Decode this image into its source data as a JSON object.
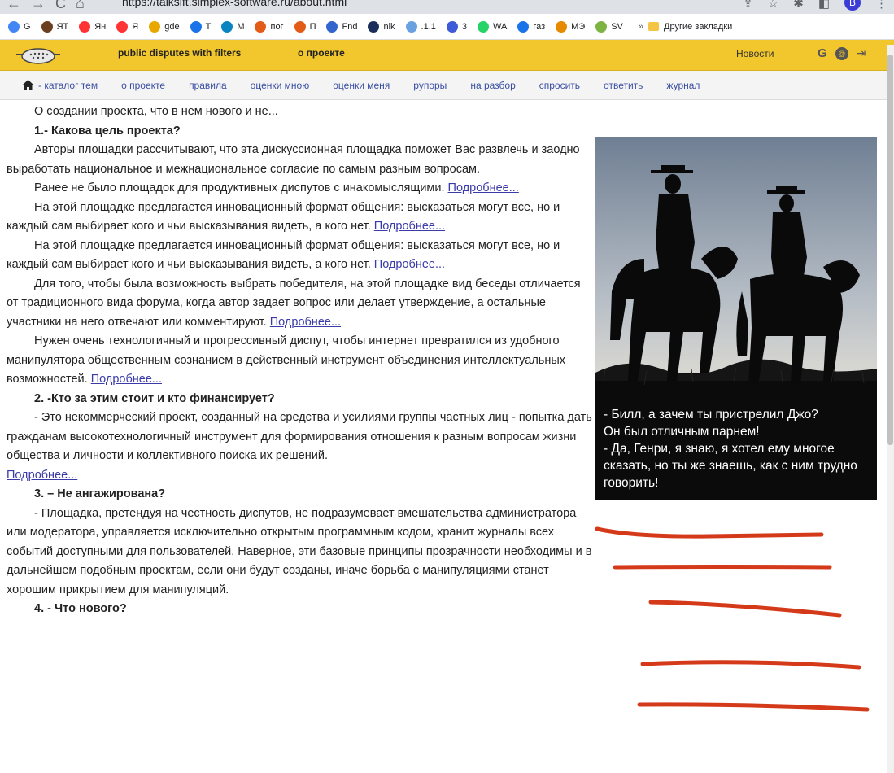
{
  "browser": {
    "url": "https://talksift.simplex-software.ru/about.html",
    "profile_initial": "B",
    "bookmarks": [
      {
        "label": "G",
        "color": "#4285f4"
      },
      {
        "label": "ЯТ",
        "color": "#6b3f20"
      },
      {
        "label": "Ян",
        "color": "#f33"
      },
      {
        "label": "Я",
        "color": "#f33"
      },
      {
        "label": "gde",
        "color": "#e8a800"
      },
      {
        "label": "Т",
        "color": "#1a73e8"
      },
      {
        "label": "М",
        "color": "#0a84c1"
      },
      {
        "label": "пог",
        "color": "#e25b17"
      },
      {
        "label": "П",
        "color": "#e25b17"
      },
      {
        "label": "Fnd",
        "color": "#3366cc"
      },
      {
        "label": "nik",
        "color": "#1b2d5a"
      },
      {
        "label": ".1.1",
        "color": "#6aa1e0"
      },
      {
        "label": "3",
        "color": "#3d5bd8"
      },
      {
        "label": "WA",
        "color": "#25d366"
      },
      {
        "label": "газ",
        "color": "#1a73e8"
      },
      {
        "label": "МЭ",
        "color": "#e68a00"
      },
      {
        "label": "SV",
        "color": "#7cb342"
      }
    ],
    "more_label": "»",
    "other_bookmarks": "Другие закладки"
  },
  "header": {
    "title": "public disputes with filters",
    "about": "о проекте",
    "news": "Новости",
    "g_icon": "G"
  },
  "menu": [
    "- каталог тем",
    "о проекте",
    "правила",
    "оценки мною",
    "оценки меня",
    "рупоры",
    "на разбор",
    "спросить",
    "ответить",
    "журнал"
  ],
  "article": {
    "intro": "О создании проекта, что в нем нового и не...",
    "h1": "1.- Какова цель проекта?",
    "p1": "Авторы площадки рассчитывают, что эта дискуссионная площадка поможет Вас развлечь и заодно выработать национальное и межнациональное согласие по самым разным вопросам.",
    "p2": "Ранее не было площадок для продуктивных диспутов с инакомыслящими.",
    "p3": "На этой площадке предлагается инновационный формат общения: высказаться могут все, но и каждый сам выбирает кого и чьи высказывания видеть, а кого нет.",
    "p4": "На этой площадке предлагается инновационный формат общения: высказаться могут все, но и каждый сам выбирает кого и чьи высказывания видеть, а кого нет.",
    "p5": "Для того, чтобы была возможность выбрать победителя, на этой площадке вид беседы отличается от традиционного вида форума, когда автор задает вопрос или делает утверждение, а остальные участники на него отвечают или комментируют.",
    "p6": "Нужен очень технологичный и прогрессивный диспут, чтобы интернет превратился из удобного манипулятора общественным сознанием в действенный инструмент объединения интеллектуальных возможностей.",
    "h2": "2. -Кто за этим стоит и кто финансирует?",
    "p7": "- Это некоммерческий проект, созданный на средства и усилиями группы частных лиц - попытка дать гражданам высокотехнологичный инструмент для формирования отношения к разным вопросам жизни общества и личности и коллективного поиска их решений.",
    "h3": "3. – Не ангажирована?",
    "p8": "- Площадка, претендуя на честность диспутов, не подразумевает вмешательства администратора или модератора, управляется исключительно открытым программным кодом, хранит журналы всех событий доступными для пользователей. Наверное, эти базовые принципы прозрачности необходимы и в дальнейшем подобным проектам, если они будут созданы, иначе борьба с манипуляциями станет хорошим прикрытием для манипуляций.",
    "h4": "4. - Что нового?",
    "more": "Подробнее..."
  },
  "image_caption": [
    "- Билл, а зачем ты пристрелил Джо?",
    "Он был отличным парнем!",
    "- Да, Генри, я знаю, я хотел ему многое сказать, но ты же знаешь, как с ним трудно говорить!"
  ],
  "colors": {
    "header_bg": "#f2c62d",
    "menu_link": "#3a4fa3",
    "annotation": "#d43a1a"
  }
}
